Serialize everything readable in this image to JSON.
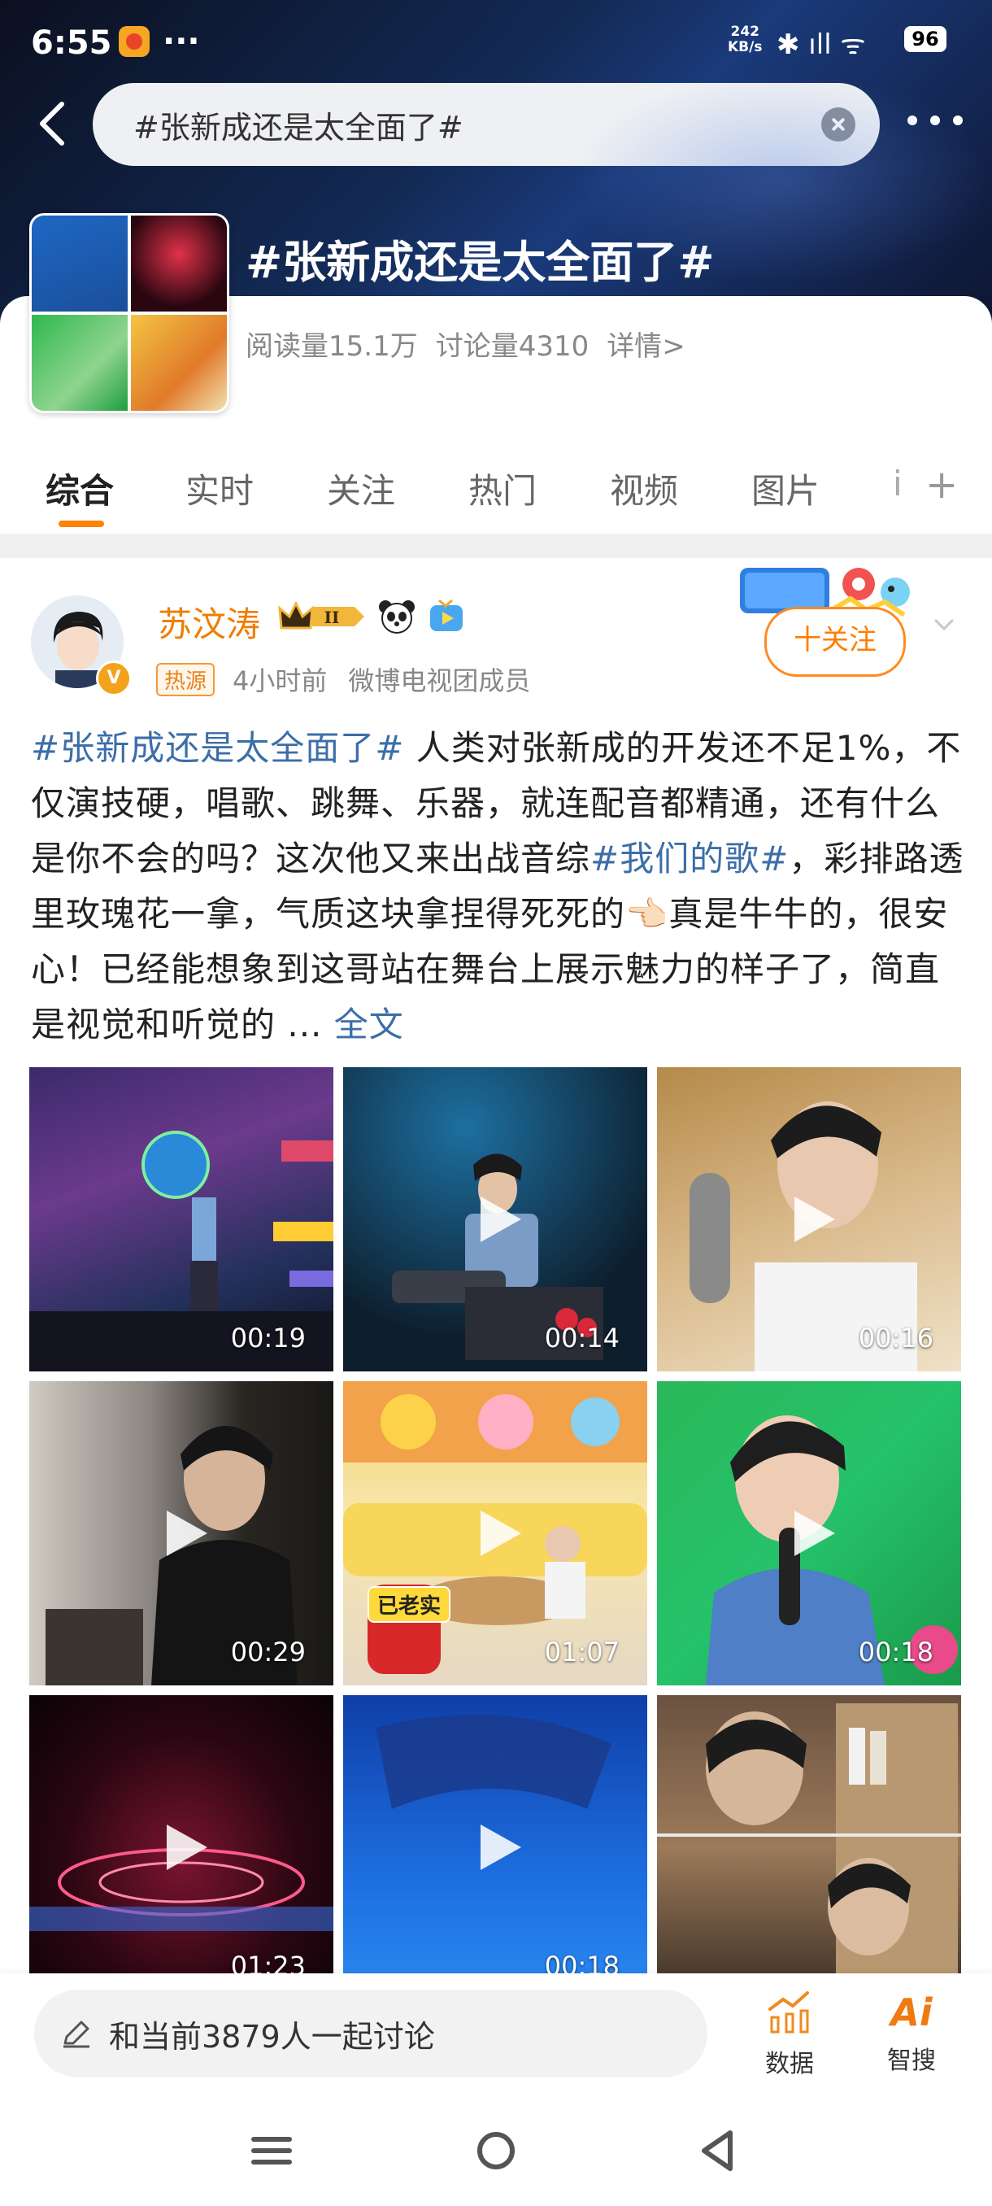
{
  "status_bar": {
    "time": "6:55",
    "dots": "···",
    "net_speed_value": "242",
    "net_speed_unit": "KB/s",
    "icons": "✱ ıll ᯤ",
    "battery": "96"
  },
  "header": {
    "search_text": "#张新成还是太全面了#",
    "topic_title": "#张新成还是太全面了#",
    "reads": "阅读量15.1万",
    "discussions": "讨论量4310",
    "details": "详情>"
  },
  "tabs": [
    {
      "label": "综合",
      "active": true
    },
    {
      "label": "实时"
    },
    {
      "label": "关注"
    },
    {
      "label": "热门"
    },
    {
      "label": "视频"
    },
    {
      "label": "图片"
    },
    {
      "label": "i"
    }
  ],
  "tab_add": "+",
  "post": {
    "author": "苏汶涛",
    "rank_badge": "II",
    "verified_mark": "V",
    "hot_tag": "热源",
    "time_ago": "4小时前",
    "member": "微博电视团成员",
    "follow": "十关注",
    "text": {
      "tag1": "#张新成还是太全面了#",
      "p1": " 人类对张新成的开发还不足1%，不仅演技硬，唱歌、跳舞、乐器，就连配音都精通，还有什么是你不会的吗？这次他又来出战音综",
      "tag2": "#我们的歌#",
      "p2": "，彩排路透里玫瑰花一拿，气质这块拿捏得死死的",
      "emoji": "👈🏻",
      "p3": "真是牛牛的，很安心！已经能想象到这哥站在舞台上展示魅力的样子了，简直是视觉和听觉的 ... ",
      "full": "全文"
    },
    "videos": [
      {
        "duration": "00:19"
      },
      {
        "duration": "00:14"
      },
      {
        "duration": "00:16"
      },
      {
        "duration": "00:29"
      },
      {
        "duration": "01:07",
        "caption": "已老实"
      },
      {
        "duration": "00:18"
      },
      {
        "duration": "01:23"
      },
      {
        "duration": "00:18"
      },
      {
        "duration": ""
      }
    ]
  },
  "bottom_bar": {
    "comment_placeholder": "和当前3879人一起讨论",
    "data_label": "数据",
    "ai_label": "智搜",
    "ai_icon_text": "Ai"
  },
  "colors": {
    "accent_orange": "#ff8200",
    "link_blue": "#3c6ea8",
    "header_dark": "#132a55"
  }
}
